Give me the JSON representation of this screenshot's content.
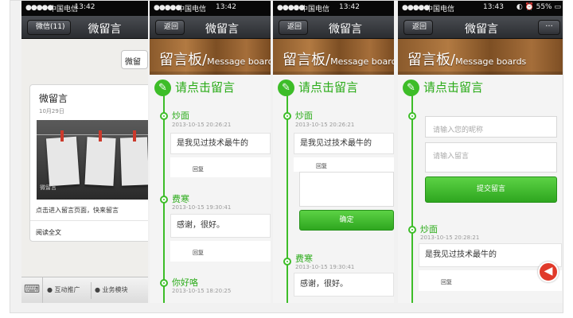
{
  "screen1": {
    "status": {
      "signal": "●●●●●",
      "carrier": "中国电信",
      "time": "13:42"
    },
    "nav": {
      "back": "微信(11)",
      "title": "微留言"
    },
    "chat_button": "微留",
    "card": {
      "title": "微留言",
      "date": "10月29日",
      "image_caption": "微留言",
      "description": "点击进入留言页面，快来留言",
      "read_more": "阅读全文"
    },
    "menu": {
      "item1": "互动推广",
      "item2": "业务模块"
    }
  },
  "screen2": {
    "status": {
      "signal": "●●●●●",
      "carrier": "中国电信",
      "time": "13:42"
    },
    "nav": {
      "back": "返回",
      "title": "微留言"
    },
    "banner": {
      "cn": "留言板/",
      "en": "Message boards"
    },
    "prompt": "请点击留言",
    "messages": [
      {
        "name": "炒面",
        "date": "2013-10-15 20:26:21",
        "text": "是我见过技术最牛的",
        "reply": "回复"
      },
      {
        "name": "费寒",
        "date": "2013-10-15 19:30:41",
        "text": "感谢，很好。",
        "reply": "回复"
      },
      {
        "name": "你好咯",
        "date": "2013-10-15 18:20:25"
      }
    ]
  },
  "screen3": {
    "status": {
      "signal": "●●●●●",
      "carrier": "中国电信",
      "time": "13:42"
    },
    "nav": {
      "back": "返回",
      "title": "微留言"
    },
    "banner": {
      "cn": "留言板/",
      "en": "Message boards"
    },
    "prompt": "请点击留言",
    "message": {
      "name": "炒面",
      "date": "2013-10-15 20:26:21",
      "text": "是我见过技术最牛的",
      "reply": "回复"
    },
    "confirm": "确定",
    "message2": {
      "name": "费寒",
      "date": "2013-10-15 19:30:41",
      "text": "感谢，很好。"
    }
  },
  "screen4": {
    "status": {
      "signal": "●●●●●",
      "carrier": "中国电信",
      "time": "13:43",
      "battery": "55%"
    },
    "nav": {
      "back": "返回",
      "title": "微留言",
      "more": "···"
    },
    "banner": {
      "cn": "留言板/",
      "en": "Message boards"
    },
    "prompt": "请点击留言",
    "form": {
      "nickname_placeholder": "请输入您的昵称",
      "message_placeholder": "请输入留言",
      "submit": "提交留言"
    },
    "message": {
      "name": "炒面",
      "date": "2013-10-15 20:28:21",
      "text": "是我见过技术最牛的",
      "reply": "回复"
    }
  },
  "icons": {
    "pencil": "✎",
    "keyboard": "⌨",
    "back_arrow": "◀"
  },
  "colors": {
    "accent_green": "#3dbd28",
    "nav_dark": "#2a2c30",
    "wood": "#9a6434",
    "back_red": "#e03a2a"
  }
}
